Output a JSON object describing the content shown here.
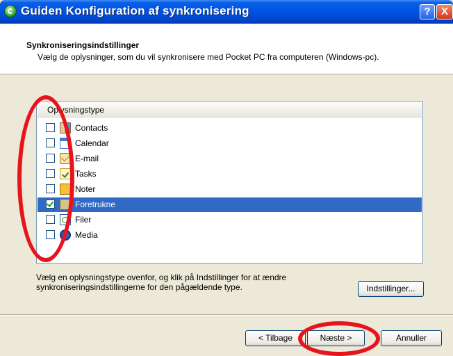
{
  "window": {
    "title": "Guiden Konfiguration af synkronisering",
    "help_label": "?",
    "close_label": "X"
  },
  "header": {
    "title": "Synkroniseringsindstillinger",
    "description": "Vælg de oplysninger, som du vil synkronisere med Pocket PC fra computeren (Windows-pc)."
  },
  "list": {
    "column_header": "Oplysningstype",
    "items": [
      {
        "label": "Contacts",
        "icon": "contacts-icon",
        "checked": false,
        "selected": false
      },
      {
        "label": "Calendar",
        "icon": "calendar-icon",
        "checked": false,
        "selected": false
      },
      {
        "label": "E-mail",
        "icon": "email-icon",
        "checked": false,
        "selected": false
      },
      {
        "label": "Tasks",
        "icon": "tasks-icon",
        "checked": false,
        "selected": false
      },
      {
        "label": "Noter",
        "icon": "notes-icon",
        "checked": false,
        "selected": false
      },
      {
        "label": "Foretrukne",
        "icon": "favorites-folder-icon",
        "checked": true,
        "selected": true
      },
      {
        "label": "Filer",
        "icon": "files-icon",
        "checked": false,
        "selected": false
      },
      {
        "label": "Media",
        "icon": "media-icon",
        "checked": false,
        "selected": false
      }
    ]
  },
  "instructions": "Vælg en oplysningstype ovenfor, og klik på Indstillinger for at ændre synkroniseringsindstillingerne for den pågældende type.",
  "buttons": {
    "settings": "Indstillinger...",
    "back": "< Tilbage",
    "next": "Næste >",
    "cancel": "Annuller"
  },
  "colors": {
    "titlebar": "#0054e3",
    "selection": "#316ac5",
    "annotation": "#e8141c",
    "dialog_bg": "#ece9d8"
  }
}
